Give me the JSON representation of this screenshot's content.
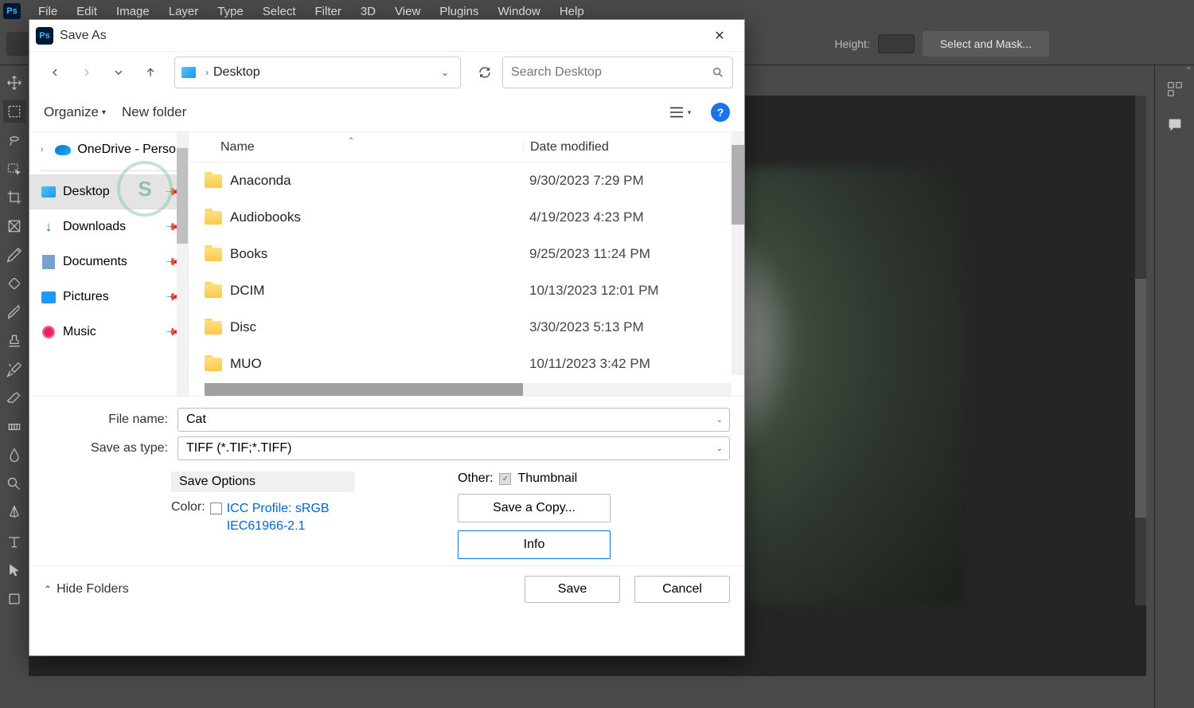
{
  "menubar": {
    "items": [
      "File",
      "Edit",
      "Image",
      "Layer",
      "Type",
      "Select",
      "Filter",
      "3D",
      "View",
      "Plugins",
      "Window",
      "Help"
    ]
  },
  "options_bar": {
    "height_label": "Height:",
    "select_mask": "Select and Mask..."
  },
  "dialog": {
    "title": "Save As",
    "path_location": "Desktop",
    "search_placeholder": "Search Desktop",
    "organize": "Organize",
    "new_folder": "New folder",
    "file_list": {
      "col_name": "Name",
      "col_date": "Date modified",
      "rows": [
        {
          "name": "Anaconda",
          "date": "9/30/2023 7:29 PM"
        },
        {
          "name": "Audiobooks",
          "date": "4/19/2023 4:23 PM"
        },
        {
          "name": "Books",
          "date": "9/25/2023 11:24 PM"
        },
        {
          "name": "DCIM",
          "date": "10/13/2023 12:01 PM"
        },
        {
          "name": "Disc",
          "date": "3/30/2023 5:13 PM"
        },
        {
          "name": "MUO",
          "date": "10/11/2023 3:42 PM"
        }
      ]
    },
    "sidebar": {
      "onedrive": "OneDrive - Personal",
      "desktop": "Desktop",
      "downloads": "Downloads",
      "documents": "Documents",
      "pictures": "Pictures",
      "music": "Music"
    },
    "filename_label": "File name:",
    "filename_value": "Cat",
    "saveastype_label": "Save as type:",
    "saveastype_value": "TIFF (*.TIF;*.TIFF)",
    "save_options_header": "Save Options",
    "color_label": "Color:",
    "icc_line1": "ICC Profile:  sRGB",
    "icc_line2": "IEC61966-2.1",
    "other_label": "Other:",
    "thumbnail_label": "Thumbnail",
    "save_copy": "Save a Copy...",
    "info": "Info",
    "hide_folders": "Hide Folders",
    "save": "Save",
    "cancel": "Cancel"
  }
}
